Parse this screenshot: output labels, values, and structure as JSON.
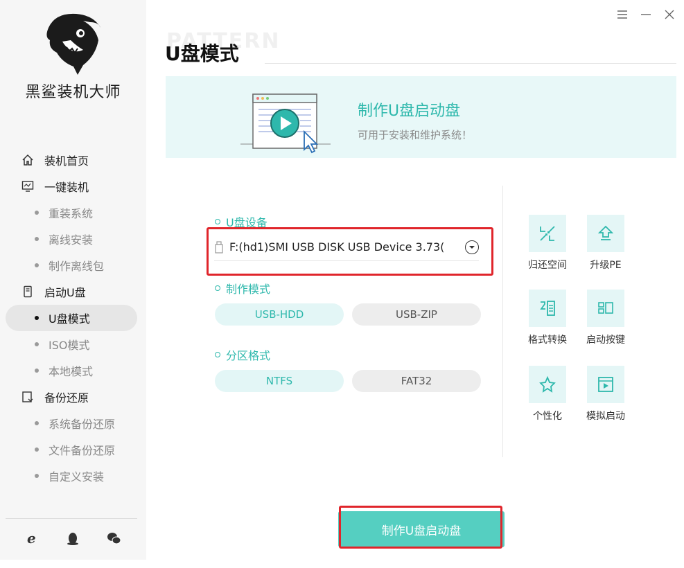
{
  "app": {
    "brand": "黑鲨装机大师",
    "watermark": "PATTERN"
  },
  "window": {
    "menu_icon": "hamburger-icon",
    "min_icon": "minimize-icon",
    "close_icon": "close-icon"
  },
  "sidebar": {
    "items": [
      {
        "label": "装机首页",
        "icon": "home-icon",
        "type": "main"
      },
      {
        "label": "一键装机",
        "icon": "monitor-icon",
        "type": "main"
      },
      {
        "label": "重装系统",
        "type": "sub"
      },
      {
        "label": "离线安装",
        "type": "sub"
      },
      {
        "label": "制作离线包",
        "type": "sub"
      },
      {
        "label": "启动U盘",
        "icon": "usb-drive-icon",
        "type": "main"
      },
      {
        "label": "U盘模式",
        "type": "sub",
        "active": true
      },
      {
        "label": "ISO模式",
        "type": "sub"
      },
      {
        "label": "本地模式",
        "type": "sub"
      },
      {
        "label": "备份还原",
        "icon": "backup-icon",
        "type": "main"
      },
      {
        "label": "系统备份还原",
        "type": "sub"
      },
      {
        "label": "文件备份还原",
        "type": "sub"
      },
      {
        "label": "自定义安装",
        "type": "sub"
      }
    ],
    "bottom_icons": [
      "ie-browser-icon",
      "qq-penguin-icon",
      "wechat-icon"
    ]
  },
  "main": {
    "title": "U盘模式",
    "banner": {
      "title": "制作U盘启动盘",
      "subtitle": "可用于安装和维护系统！"
    },
    "device_label": "U盘设备",
    "device_value": "F:(hd1)SMI USB DISK USB Device 3.73(",
    "mode_label": "制作模式",
    "modes": [
      "USB-HDD",
      "USB-ZIP"
    ],
    "partition_label": "分区格式",
    "partitions": [
      "NTFS",
      "FAT32"
    ],
    "tools": [
      {
        "label": "归还空间",
        "icon": "shrink-arrows-icon"
      },
      {
        "label": "升级PE",
        "icon": "upgrade-arrow-icon"
      },
      {
        "label": "格式转换",
        "icon": "format-convert-icon"
      },
      {
        "label": "启动按键",
        "icon": "boot-keys-icon"
      },
      {
        "label": "个性化",
        "icon": "personalize-star-icon"
      },
      {
        "label": "模拟启动",
        "icon": "simulate-boot-icon"
      }
    ],
    "primary_button": "制作U盘启动盘"
  },
  "colors": {
    "accent": "#2eb8ac",
    "button": "#55cfc1",
    "highlight": "#e0252b",
    "sidebar_bg": "#f6f6f6"
  }
}
